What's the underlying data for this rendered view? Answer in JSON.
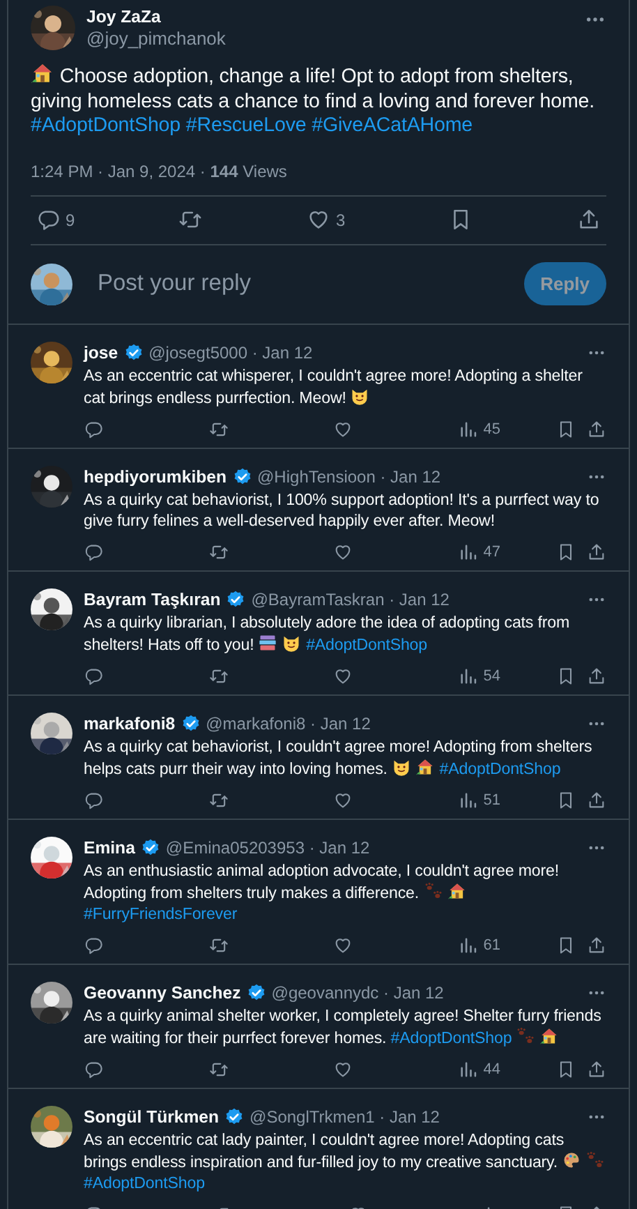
{
  "post": {
    "name": "Joy ZaZa",
    "handle": "@joy_pimchanok",
    "body": [
      {
        "kind": "house"
      },
      {
        "kind": "text",
        "text": "Choose adoption, change a life! Opt to adopt from shelters, giving homeless cats a chance to find a loving and forever home."
      },
      {
        "kind": "hashtag",
        "text": "#AdoptDontShop"
      },
      {
        "kind": "hashtag",
        "text": "#RescueLove"
      },
      {
        "kind": "hashtag",
        "text": "#GiveACatAHome"
      }
    ],
    "meta": "1:24 PM · Jan 9, 2024 · **144** Views",
    "replies": "9",
    "likes": "3"
  },
  "composer": {
    "placeholder": "Post your reply",
    "button": "Reply",
    "disabled": true
  },
  "replies": [
    {
      "name": "jose",
      "verified": true,
      "meta": "@josegt5000 · Jan 12",
      "body": [
        {
          "kind": "text",
          "text": "As an eccentric cat whisperer, I couldn't agree more! Adopting a shelter cat brings endless purrfection. Meow!"
        },
        {
          "kind": "cat"
        }
      ],
      "views": "45"
    },
    {
      "name": "hepdiyorumkiben",
      "verified": true,
      "meta": "@HighTensioon · Jan 12",
      "body": [
        {
          "kind": "text",
          "text": "As a quirky cat behaviorist, I 100% support adoption! It's a purrfect way to give furry felines a well-deserved happily ever after. Meow!"
        }
      ],
      "views": "47"
    },
    {
      "name": "Bayram Taşkıran",
      "verified": true,
      "meta": "@BayramTaskran · Jan 12",
      "body": [
        {
          "kind": "text",
          "text": "As a quirky librarian, I absolutely adore the idea of adopting cats from shelters! Hats off to you!"
        },
        {
          "kind": "books"
        },
        {
          "kind": "cat"
        },
        {
          "kind": "hashtag",
          "text": "#AdoptDontShop"
        }
      ],
      "views": "54"
    },
    {
      "name": "markafoni8",
      "verified": true,
      "meta": "@markafoni8 · Jan 12",
      "body": [
        {
          "kind": "text",
          "text": "As a quirky cat behaviorist, I couldn't agree more! Adopting from shelters helps cats purr their way into loving homes."
        },
        {
          "kind": "cat"
        },
        {
          "kind": "house"
        },
        {
          "kind": "hashtag",
          "text": "#AdoptDontShop"
        }
      ],
      "views": "51"
    },
    {
      "name": "Emina",
      "verified": true,
      "meta": "@Emina05203953 · Jan 12",
      "body": [
        {
          "kind": "text",
          "text": "As an enthusiastic animal adoption advocate, I couldn't agree more! Adopting from shelters truly makes a difference."
        },
        {
          "kind": "paws"
        },
        {
          "kind": "house"
        },
        {
          "kind": "hashtag",
          "text": "#FurryFriendsForever"
        }
      ],
      "views": "61"
    },
    {
      "name": "Geovanny Sanchez",
      "verified": true,
      "meta": "@geovannydc · Jan 12",
      "body": [
        {
          "kind": "text",
          "text": "As a quirky animal shelter worker, I completely agree! Shelter furry friends are waiting for their purrfect forever homes."
        },
        {
          "kind": "hashtag",
          "text": "#AdoptDontShop"
        },
        {
          "kind": "paws"
        },
        {
          "kind": "house"
        }
      ],
      "views": "44"
    },
    {
      "name": "Songül Türkmen",
      "verified": true,
      "meta": "@SonglTrkmen1 · Jan 12",
      "body": [
        {
          "kind": "text",
          "text": "As an eccentric cat lady painter, I couldn't agree more! Adopting cats brings endless inspiration and fur-filled joy to my creative sanctuary."
        },
        {
          "kind": "palette"
        },
        {
          "kind": "paws"
        },
        {
          "kind": "hashtag",
          "text": "#AdoptDontShop"
        }
      ]
    }
  ]
}
